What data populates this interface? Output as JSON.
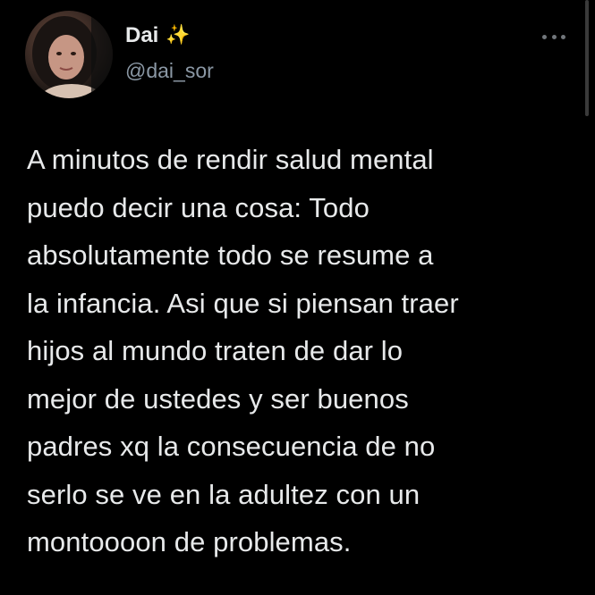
{
  "author": {
    "display_name": "Dai",
    "badge_emoji": "✨",
    "handle": "@dai_sor"
  },
  "icons": {
    "avatar": "profile-photo",
    "more": "more-options-icon",
    "badge": "sparkles-icon"
  },
  "tweet": {
    "text": "A minutos de rendir salud mental\npuedo decir una cosa: Todo\nabsolutamente todo se resume a\nla infancia. Asi que si piensan traer\nhijos al mundo traten de dar lo\nmejor de ustedes y ser buenos\npadres xq la consecuencia de no\nserlo se ve en la adultez con un\nmontoooon de problemas."
  },
  "colors": {
    "background": "#000000",
    "primary_text": "#e7e9ea",
    "secondary_text": "#8b98a5"
  }
}
